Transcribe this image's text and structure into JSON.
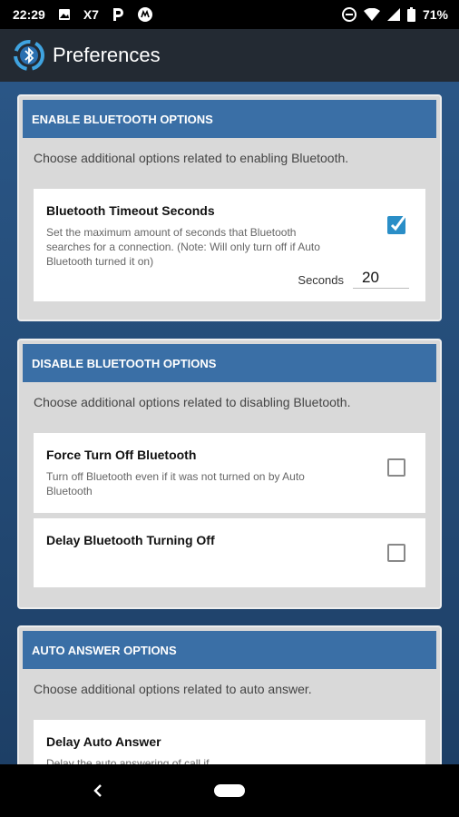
{
  "status_bar": {
    "time": "22:29",
    "carrier_badge": "X7",
    "battery": "71%"
  },
  "app_bar": {
    "title": "Preferences"
  },
  "sections": [
    {
      "header": "ENABLE BLUETOOTH OPTIONS",
      "description": "Choose additional options related to enabling Bluetooth.",
      "items": [
        {
          "title": "Bluetooth Timeout Seconds",
          "description": "Set the maximum amount of seconds that Bluetooth searches for a connection. (Note: Will only turn off if Auto Bluetooth turned it on)",
          "checked": true,
          "seconds_label": "Seconds",
          "seconds_value": "20"
        }
      ]
    },
    {
      "header": "DISABLE BLUETOOTH OPTIONS",
      "description": "Choose additional options related to disabling Bluetooth.",
      "items": [
        {
          "title": "Force Turn Off Bluetooth",
          "description": "Turn off Bluetooth even if it was not turned on by Auto Bluetooth",
          "checked": false
        },
        {
          "title": "Delay Bluetooth Turning Off",
          "checked": false
        }
      ]
    },
    {
      "header": "AUTO ANSWER OPTIONS",
      "description": "Choose additional options related to auto answer.",
      "items": [
        {
          "title": "Delay Auto Answer",
          "description": "Delay the auto answering of call if..."
        }
      ]
    }
  ],
  "colors": {
    "header_blue": "#3a6fa6",
    "checkbox_accent": "#2a8ec7",
    "app_bar": "#232a33"
  }
}
